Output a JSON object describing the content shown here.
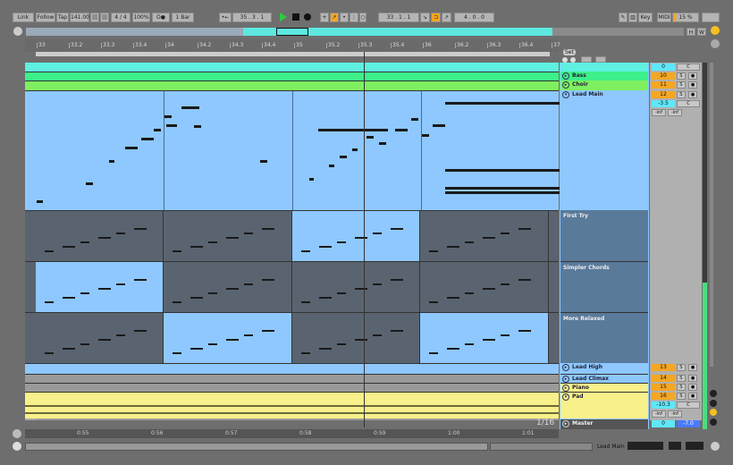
{
  "toolbar": {
    "link": "Link",
    "follow": "Follow",
    "tap": "Tap",
    "tempo": "141.00",
    "signature": "4 / 4",
    "zoom": "100%",
    "metro": "O●",
    "quantize": "1 Bar",
    "position": "35 .  3 .  1",
    "loop_start": "33 .  1 .  1",
    "loop_length": "4 .  0 .  0",
    "key": "Key",
    "midi": "MIDI",
    "cpu": "15 %"
  },
  "overview": {
    "h": "H",
    "w": "W"
  },
  "ruler": [
    "33",
    "33.2",
    "33.3",
    "33.4",
    "34",
    "34.2",
    "34.3",
    "34.4",
    "35",
    "35.2",
    "35.3",
    "35.4",
    "36",
    "36.2",
    "36.3",
    "36.4",
    "37"
  ],
  "set_label": "Set",
  "tracks": [
    {
      "name": "",
      "vol": "0",
      "pan": "C",
      "color": "#5ef0e0"
    },
    {
      "name": "Bass",
      "num": "10",
      "s": "S",
      "color": "#3df08a"
    },
    {
      "name": "Choir",
      "num": "11",
      "s": "S",
      "color": "#7ef060"
    },
    {
      "name": "Lead Main",
      "num": "12",
      "s": "S",
      "vol": "-3.5",
      "pan": "C",
      "sendA": "-inf",
      "sendB": "-inf",
      "color": "#8ec8ff"
    },
    {
      "name": "Lead High",
      "num": "13",
      "s": "S",
      "color": "#8ec8ff"
    },
    {
      "name": "Lead Climax",
      "num": "14",
      "s": "S",
      "color": "#8ec8ff"
    },
    {
      "name": "Piano",
      "num": "15",
      "s": "S",
      "color": "#f8f08a"
    },
    {
      "name": "Pad",
      "num": "16",
      "s": "S",
      "vol": "-10.3",
      "pan": "C",
      "sendA": "-inf",
      "sendB": "-inf",
      "color": "#f8f08a"
    }
  ],
  "lanes": [
    "First Try",
    "Simpler Chords",
    "More Relaxed"
  ],
  "master": {
    "name": "Master",
    "vol": "0",
    "pan": "-7.0"
  },
  "grid": "1/16",
  "time_ruler": [
    "0:55",
    "0:56",
    "0:57",
    "0:58",
    "0:59",
    "1:00",
    "1:01"
  ],
  "status": {
    "track": "Lead Main"
  },
  "colors": {
    "accent": "#f5a623",
    "play": "#2ecc40",
    "clip_blue": "#8ec8ff",
    "lane_gray": "#5a6470"
  }
}
